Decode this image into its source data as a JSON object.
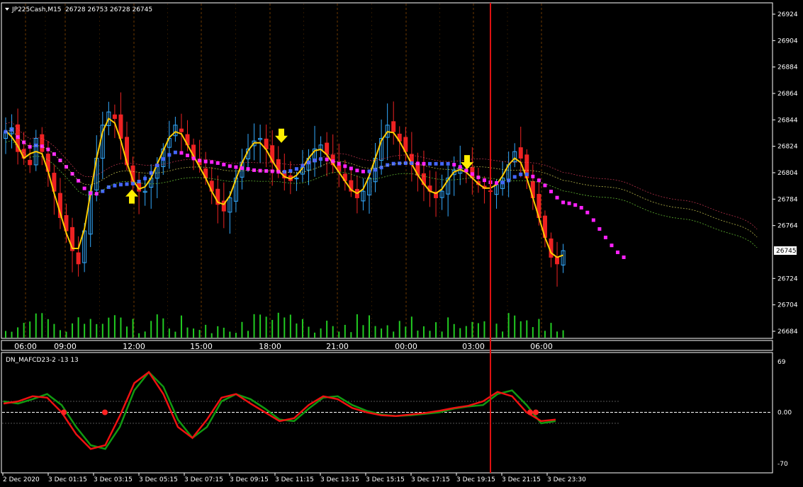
{
  "header": {
    "symbol": "JP225Cash,M15",
    "ohlc": "26728 26753 26728 26745"
  },
  "sub_header": {
    "indicator": "DN_MAFCD23-2 -13 13"
  },
  "colors": {
    "bull": "#33aaff",
    "bear": "#ee2222",
    "volume": "#22cc22",
    "yellow_ma": "#ffcc00",
    "magenta_ma": "#ff22ff",
    "blue_ma": "#4466ff",
    "osc_green": "#119911",
    "osc_red": "#ee1111",
    "vline": "#dd1111",
    "grid": "#ff8800"
  },
  "chart_data": [
    {
      "type": "candlestick",
      "title": "JP225Cash,M15",
      "yticks": [
        "26924",
        "26904",
        "26884",
        "26864",
        "26844",
        "26824",
        "26804",
        "26784",
        "26764",
        "26745",
        "26724",
        "26704",
        "26684"
      ],
      "ylim": [
        26676,
        26932
      ],
      "current_price": "26745",
      "time_labels": [
        "06:00",
        "09:00",
        "12:00",
        "15:00",
        "18:00",
        "21:00",
        "00:00",
        "03:00",
        "06:00"
      ],
      "arrows": [
        {
          "dir": "up",
          "value": 26786
        },
        {
          "dir": "down",
          "value": 26832
        },
        {
          "dir": "down",
          "value": 26812
        }
      ],
      "close_estimates": [
        26835,
        26838,
        26820,
        26815,
        26810,
        26830,
        26820,
        26805,
        26790,
        26770,
        26760,
        26745,
        26735,
        26760,
        26790,
        26815,
        26840,
        26850,
        26845,
        26830,
        26810,
        26795,
        26790,
        26790,
        26800,
        26810,
        26822,
        26830,
        26840,
        26835,
        26825,
        26815,
        26810,
        26800,
        26790,
        26780,
        26775,
        26785,
        26800,
        26812,
        26822,
        26828,
        26830,
        26822,
        26812,
        26805,
        26800,
        26798,
        26800,
        26808,
        26815,
        26822,
        26825,
        26818,
        26810,
        26805,
        26798,
        26790,
        26785,
        26790,
        26800,
        26815,
        26830,
        26840,
        26835,
        26828,
        26820,
        26810,
        26802,
        26795,
        26790,
        26785,
        26790,
        26800,
        26806,
        26808,
        26805,
        26800,
        26795,
        26792,
        26790,
        26795,
        26800,
        26810,
        26820,
        26815,
        26800,
        26785,
        26770,
        26755,
        26740,
        26735,
        26745
      ]
    },
    {
      "type": "line",
      "title": "DN_MAFCD23-2 -13 13",
      "yticks": [
        "69",
        "0.00",
        "-70"
      ],
      "ylim": [
        -75,
        75
      ],
      "time_labels": [
        "2 Dec 2020",
        "3 Dec 01:15",
        "3 Dec 03:15",
        "3 Dec 05:15",
        "3 Dec 07:15",
        "3 Dec 09:15",
        "3 Dec 11:15",
        "3 Dec 13:15",
        "3 Dec 15:15",
        "3 Dec 17:15",
        "3 Dec 19:15",
        "3 Dec 21:15",
        "3 Dec 23:30"
      ],
      "series": [
        {
          "values": [
            15,
            12,
            18,
            25,
            10,
            -20,
            -45,
            -50,
            -20,
            30,
            55,
            35,
            -10,
            -35,
            -20,
            15,
            25,
            18,
            5,
            -10,
            -12,
            5,
            20,
            22,
            10,
            2,
            -3,
            -5,
            -4,
            -2,
            0,
            5,
            8,
            10,
            25,
            30,
            10,
            -15,
            -12
          ]
        },
        {
          "values": [
            12,
            15,
            22,
            20,
            0,
            -30,
            -50,
            -45,
            -5,
            40,
            55,
            25,
            -20,
            -35,
            -10,
            20,
            25,
            12,
            0,
            -12,
            -8,
            10,
            22,
            18,
            6,
            0,
            -4,
            -5,
            -3,
            -1,
            2,
            6,
            9,
            15,
            28,
            22,
            0,
            -12,
            -10
          ]
        }
      ]
    }
  ]
}
